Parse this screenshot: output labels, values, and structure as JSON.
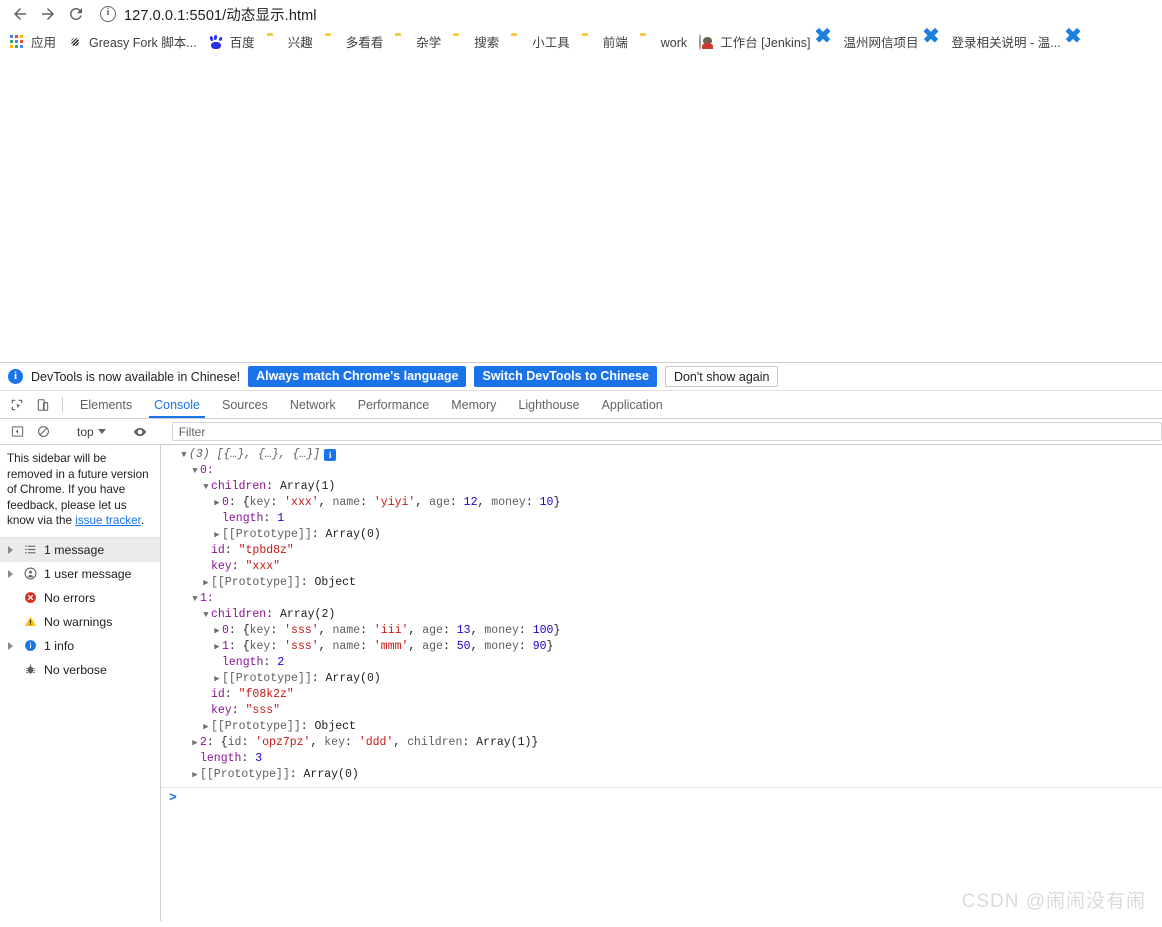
{
  "browser": {
    "back_label": "Back",
    "forward_label": "Forward",
    "reload_label": "Reload",
    "url": "127.0.0.1:5501/动态显示.html",
    "site_info_label": "View site information"
  },
  "bookmarks": [
    {
      "label": "应用",
      "icon": "apps-grid-icon"
    },
    {
      "label": "Greasy Fork 脚本...",
      "icon": "greasyfork-icon"
    },
    {
      "label": "百度",
      "icon": "baidu-icon"
    },
    {
      "label": "兴趣",
      "icon": "folder-icon"
    },
    {
      "label": "多看看",
      "icon": "folder-icon"
    },
    {
      "label": "杂学",
      "icon": "folder-icon"
    },
    {
      "label": "搜索",
      "icon": "folder-icon"
    },
    {
      "label": "小工具",
      "icon": "folder-icon"
    },
    {
      "label": "前端",
      "icon": "folder-icon"
    },
    {
      "label": "work",
      "icon": "folder-icon"
    },
    {
      "label": "工作台 [Jenkins]",
      "icon": "jenkins-icon"
    },
    {
      "label": "温州网信项目",
      "icon": "blue-x-icon"
    },
    {
      "label": "登录相关说明 - 温...",
      "icon": "blue-x-icon"
    },
    {
      "label": "",
      "icon": "blue-x-icon"
    }
  ],
  "devtools": {
    "notice": {
      "text": "DevTools is now available in Chinese!",
      "btn_always": "Always match Chrome's language",
      "btn_switch": "Switch DevTools to Chinese",
      "btn_dismiss": "Don't show again",
      "info_glyph": "i"
    },
    "tools": {
      "inspect_label": "Inspect element",
      "device_toolbar_label": "Toggle device toolbar"
    },
    "tabs": [
      {
        "label": "Elements",
        "active": false
      },
      {
        "label": "Console",
        "active": true
      },
      {
        "label": "Sources",
        "active": false
      },
      {
        "label": "Network",
        "active": false
      },
      {
        "label": "Performance",
        "active": false
      },
      {
        "label": "Memory",
        "active": false
      },
      {
        "label": "Lighthouse",
        "active": false
      },
      {
        "label": "Application",
        "active": false
      }
    ],
    "console_toolbar": {
      "sidebar_toggle_label": "Show console sidebar",
      "clear_label": "Clear console",
      "context_value": "top",
      "eye_label": "Create live expression",
      "filter_placeholder": "Filter"
    },
    "sidebar": {
      "notice_prefix": "This sidebar will be removed in a future version of Chrome. If you have feedback, please let us know via the ",
      "notice_link": "issue tracker",
      "notice_suffix": ".",
      "items": [
        {
          "label": "1 message",
          "icon": "list-icon",
          "expandable": true,
          "selected": true
        },
        {
          "label": "1 user message",
          "icon": "user-icon",
          "expandable": true,
          "selected": false
        },
        {
          "label": "No errors",
          "icon": "error-icon",
          "expandable": false,
          "selected": false
        },
        {
          "label": "No warnings",
          "icon": "warning-icon",
          "expandable": false,
          "selected": false
        },
        {
          "label": "1 info",
          "icon": "info-icon",
          "expandable": true,
          "selected": false
        },
        {
          "label": "No verbose",
          "icon": "bug-icon",
          "expandable": false,
          "selected": false
        }
      ]
    },
    "output": {
      "header": {
        "count": "(3)",
        "preview": "[{…}, {…}, {…}]",
        "info_glyph": "i"
      },
      "lines": [
        {
          "indent": 1,
          "tri": "open",
          "segs": [
            {
              "t": "0:",
              "c": "prop"
            }
          ]
        },
        {
          "indent": 2,
          "tri": "open",
          "segs": [
            {
              "t": "children",
              "c": "prop"
            },
            {
              "t": ": ",
              "c": "name"
            },
            {
              "t": "Array(1)",
              "c": "name"
            }
          ]
        },
        {
          "indent": 3,
          "tri": "closed",
          "segs": [
            {
              "t": "0",
              "c": "prop"
            },
            {
              "t": ": {",
              "c": "name"
            },
            {
              "t": "key",
              "c": "gray"
            },
            {
              "t": ": ",
              "c": "name"
            },
            {
              "t": "'xxx'",
              "c": "str"
            },
            {
              "t": ", ",
              "c": "name"
            },
            {
              "t": "name",
              "c": "gray"
            },
            {
              "t": ": ",
              "c": "name"
            },
            {
              "t": "'yiyi'",
              "c": "str"
            },
            {
              "t": ", ",
              "c": "name"
            },
            {
              "t": "age",
              "c": "gray"
            },
            {
              "t": ": ",
              "c": "name"
            },
            {
              "t": "12",
              "c": "num"
            },
            {
              "t": ", ",
              "c": "name"
            },
            {
              "t": "money",
              "c": "gray"
            },
            {
              "t": ": ",
              "c": "name"
            },
            {
              "t": "10",
              "c": "num"
            },
            {
              "t": "}",
              "c": "name"
            }
          ]
        },
        {
          "indent": 3,
          "tri": "none",
          "segs": [
            {
              "t": "length",
              "c": "prop"
            },
            {
              "t": ": ",
              "c": "name"
            },
            {
              "t": "1",
              "c": "num"
            }
          ]
        },
        {
          "indent": 3,
          "tri": "closed",
          "segs": [
            {
              "t": "[[Prototype]]",
              "c": "gray"
            },
            {
              "t": ": ",
              "c": "name"
            },
            {
              "t": "Array(0)",
              "c": "name"
            }
          ]
        },
        {
          "indent": 2,
          "tri": "none",
          "segs": [
            {
              "t": "id",
              "c": "prop"
            },
            {
              "t": ": ",
              "c": "name"
            },
            {
              "t": "\"tpbd8z\"",
              "c": "str"
            }
          ]
        },
        {
          "indent": 2,
          "tri": "none",
          "segs": [
            {
              "t": "key",
              "c": "prop"
            },
            {
              "t": ": ",
              "c": "name"
            },
            {
              "t": "\"xxx\"",
              "c": "str"
            }
          ]
        },
        {
          "indent": 2,
          "tri": "closed",
          "segs": [
            {
              "t": "[[Prototype]]",
              "c": "gray"
            },
            {
              "t": ": ",
              "c": "name"
            },
            {
              "t": "Object",
              "c": "name"
            }
          ]
        },
        {
          "indent": 1,
          "tri": "open",
          "segs": [
            {
              "t": "1:",
              "c": "prop"
            }
          ]
        },
        {
          "indent": 2,
          "tri": "open",
          "segs": [
            {
              "t": "children",
              "c": "prop"
            },
            {
              "t": ": ",
              "c": "name"
            },
            {
              "t": "Array(2)",
              "c": "name"
            }
          ]
        },
        {
          "indent": 3,
          "tri": "closed",
          "segs": [
            {
              "t": "0",
              "c": "prop"
            },
            {
              "t": ": {",
              "c": "name"
            },
            {
              "t": "key",
              "c": "gray"
            },
            {
              "t": ": ",
              "c": "name"
            },
            {
              "t": "'sss'",
              "c": "str"
            },
            {
              "t": ", ",
              "c": "name"
            },
            {
              "t": "name",
              "c": "gray"
            },
            {
              "t": ": ",
              "c": "name"
            },
            {
              "t": "'iii'",
              "c": "str"
            },
            {
              "t": ", ",
              "c": "name"
            },
            {
              "t": "age",
              "c": "gray"
            },
            {
              "t": ": ",
              "c": "name"
            },
            {
              "t": "13",
              "c": "num"
            },
            {
              "t": ", ",
              "c": "name"
            },
            {
              "t": "money",
              "c": "gray"
            },
            {
              "t": ": ",
              "c": "name"
            },
            {
              "t": "100",
              "c": "num"
            },
            {
              "t": "}",
              "c": "name"
            }
          ]
        },
        {
          "indent": 3,
          "tri": "closed",
          "segs": [
            {
              "t": "1",
              "c": "prop"
            },
            {
              "t": ": {",
              "c": "name"
            },
            {
              "t": "key",
              "c": "gray"
            },
            {
              "t": ": ",
              "c": "name"
            },
            {
              "t": "'sss'",
              "c": "str"
            },
            {
              "t": ", ",
              "c": "name"
            },
            {
              "t": "name",
              "c": "gray"
            },
            {
              "t": ": ",
              "c": "name"
            },
            {
              "t": "'mmm'",
              "c": "str"
            },
            {
              "t": ", ",
              "c": "name"
            },
            {
              "t": "age",
              "c": "gray"
            },
            {
              "t": ": ",
              "c": "name"
            },
            {
              "t": "50",
              "c": "num"
            },
            {
              "t": ", ",
              "c": "name"
            },
            {
              "t": "money",
              "c": "gray"
            },
            {
              "t": ": ",
              "c": "name"
            },
            {
              "t": "90",
              "c": "num"
            },
            {
              "t": "}",
              "c": "name"
            }
          ]
        },
        {
          "indent": 3,
          "tri": "none",
          "segs": [
            {
              "t": "length",
              "c": "prop"
            },
            {
              "t": ": ",
              "c": "name"
            },
            {
              "t": "2",
              "c": "num"
            }
          ]
        },
        {
          "indent": 3,
          "tri": "closed",
          "segs": [
            {
              "t": "[[Prototype]]",
              "c": "gray"
            },
            {
              "t": ": ",
              "c": "name"
            },
            {
              "t": "Array(0)",
              "c": "name"
            }
          ]
        },
        {
          "indent": 2,
          "tri": "none",
          "segs": [
            {
              "t": "id",
              "c": "prop"
            },
            {
              "t": ": ",
              "c": "name"
            },
            {
              "t": "\"f08k2z\"",
              "c": "str"
            }
          ]
        },
        {
          "indent": 2,
          "tri": "none",
          "segs": [
            {
              "t": "key",
              "c": "prop"
            },
            {
              "t": ": ",
              "c": "name"
            },
            {
              "t": "\"sss\"",
              "c": "str"
            }
          ]
        },
        {
          "indent": 2,
          "tri": "closed",
          "segs": [
            {
              "t": "[[Prototype]]",
              "c": "gray"
            },
            {
              "t": ": ",
              "c": "name"
            },
            {
              "t": "Object",
              "c": "name"
            }
          ]
        },
        {
          "indent": 1,
          "tri": "closed",
          "segs": [
            {
              "t": "2",
              "c": "prop"
            },
            {
              "t": ": {",
              "c": "name"
            },
            {
              "t": "id",
              "c": "gray"
            },
            {
              "t": ": ",
              "c": "name"
            },
            {
              "t": "'opz7pz'",
              "c": "str"
            },
            {
              "t": ", ",
              "c": "name"
            },
            {
              "t": "key",
              "c": "gray"
            },
            {
              "t": ": ",
              "c": "name"
            },
            {
              "t": "'ddd'",
              "c": "str"
            },
            {
              "t": ", ",
              "c": "name"
            },
            {
              "t": "children",
              "c": "gray"
            },
            {
              "t": ": ",
              "c": "name"
            },
            {
              "t": "Array(1)",
              "c": "name"
            },
            {
              "t": "}",
              "c": "name"
            }
          ]
        },
        {
          "indent": 1,
          "tri": "none",
          "segs": [
            {
              "t": "length",
              "c": "prop"
            },
            {
              "t": ": ",
              "c": "name"
            },
            {
              "t": "3",
              "c": "num"
            }
          ]
        },
        {
          "indent": 1,
          "tri": "closed",
          "segs": [
            {
              "t": "[[Prototype]]",
              "c": "gray"
            },
            {
              "t": ": ",
              "c": "name"
            },
            {
              "t": "Array(0)",
              "c": "name"
            }
          ]
        }
      ],
      "prompt": ">"
    }
  },
  "watermark": "CSDN @闹闹没有闹"
}
